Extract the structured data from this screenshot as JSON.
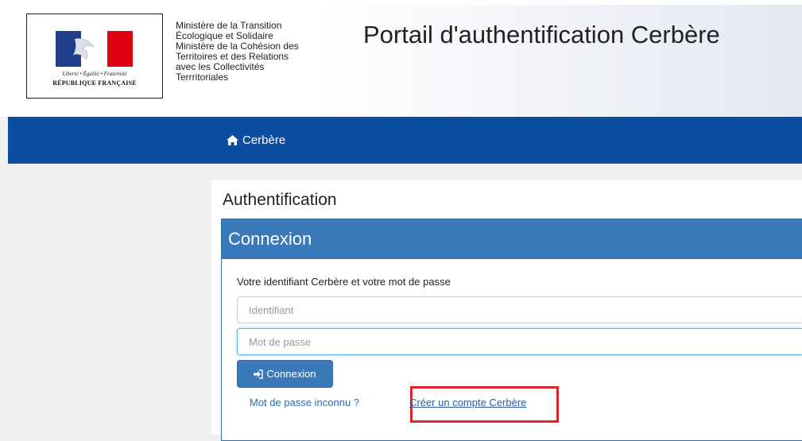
{
  "header": {
    "logo": {
      "motto": "Liberté • Égalité • Fraternité",
      "republic": "RÉPUBLIQUE FRANÇAISE"
    },
    "ministry_text": "Ministère de la Transition\nÉcologique et Solidaire\nMinistère de la Cohésion des\nTerritoires et des Relations\navec les Collectivités\nTerrritoriales",
    "portal_title": "Portail d'authentification Cerbère"
  },
  "navbar": {
    "brand_label": "Cerbère",
    "brand_icon": "home-icon",
    "color": "#0b4da1"
  },
  "main": {
    "title": "Authentification",
    "panel": {
      "heading": "Connexion",
      "instructions": "Votre identifiant Cerbère et votre mot de passe",
      "identifiant_placeholder": "Identifiant",
      "password_placeholder": "Mot de passe",
      "submit_label": "Connexion",
      "submit_icon": "sign-in-icon",
      "forgot_link": "Mot de passe inconnu ?",
      "create_link": "Créer un compte Cerbère"
    }
  },
  "colors": {
    "accent": "#3a79b9",
    "highlight": "#e1232e",
    "link": "#2a6bb3"
  }
}
